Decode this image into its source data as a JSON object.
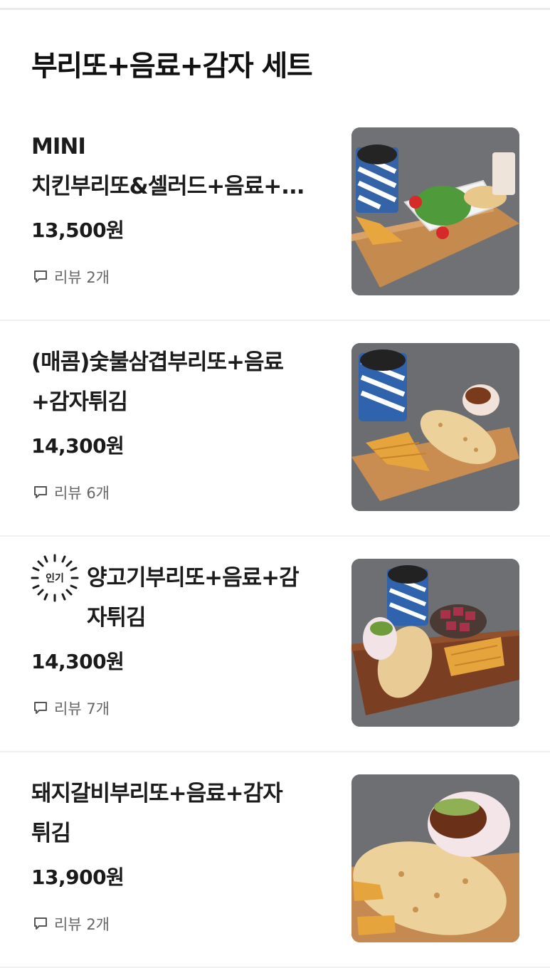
{
  "section": {
    "title": "부리또+음료+감자 세트"
  },
  "items": [
    {
      "name": "MINI\n치킨부리또&셀러드+음료+...",
      "price": "13,500원",
      "review": "리뷰 2개",
      "badge": ""
    },
    {
      "name": "(매콤)숯불삼겹부리또+음료\n+감자튀김",
      "price": "14,300원",
      "review": "리뷰 6개",
      "badge": ""
    },
    {
      "name": "양고기부리또+음료+감\n자튀김",
      "price": "14,300원",
      "review": "리뷰 7개",
      "badge": "인기"
    },
    {
      "name": "돼지갈비부리또+음료+감자\n튀김",
      "price": "13,900원",
      "review": "리뷰 2개",
      "badge": ""
    }
  ],
  "icons": {
    "review": "speech-bubble-icon",
    "badge": "popular-burst-badge"
  }
}
